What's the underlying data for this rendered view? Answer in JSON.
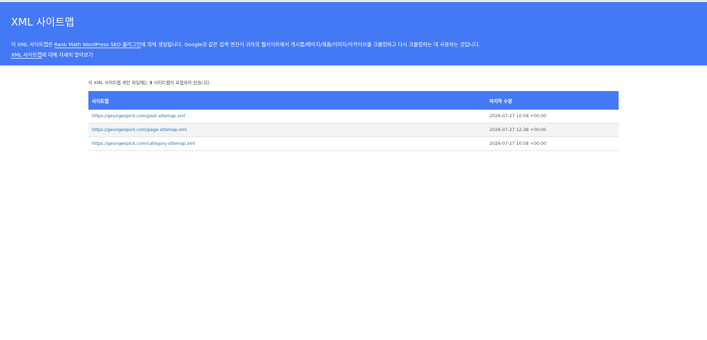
{
  "header": {
    "title": "XML 사이트맵",
    "desc_part1": "이 XML 사이트맵은 ",
    "desc_link": "Rank Math WordPress SEO 플러그인",
    "desc_part2": "에 의해 생성됩니다. Google과 같은 검색 엔진이 귀하의 웹사이트에서 게시물/페이지/제품/이미지/아카이브를 크롤링하고 다시 크롤링하는 데 사용하는 것입니다.",
    "more_link": "XML 사이트맵",
    "more_text": "에 대해 자세히 알아보기"
  },
  "summary": {
    "prefix": "이 XML 사이트맵 색인 파일에는 ",
    "count": "3",
    "suffix": " 사이트맵이 포함되어 있습니다."
  },
  "table": {
    "col_sitemap": "사이트맵",
    "col_lastmod": "마지막 수정",
    "rows": [
      {
        "url": "https://geungeopick.com/post-sitemap.xml",
        "lastmod": "2026-07-27 10:58 +00:00"
      },
      {
        "url": "https://geungeopick.com/page-sitemap.xml",
        "lastmod": "2026-07-27 12:38 +00:00"
      },
      {
        "url": "https://geungeopick.com/category-sitemap.xml",
        "lastmod": "2026-07-27 10:58 +00:00"
      }
    ]
  },
  "colors": {
    "accent": "#4479f6",
    "link": "#2a6fa8"
  }
}
